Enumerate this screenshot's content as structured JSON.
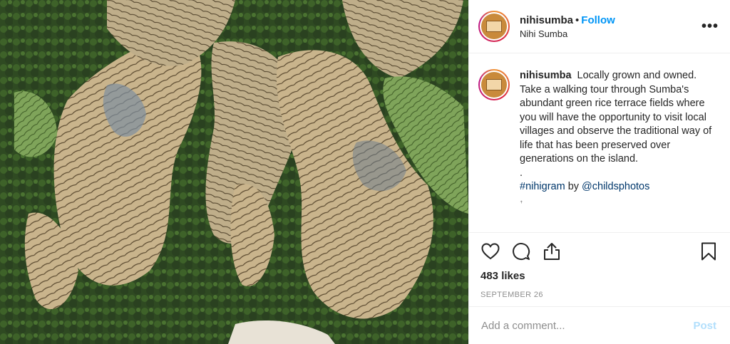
{
  "photo": {
    "icon": "aerial-rice-terraces-image"
  },
  "header": {
    "username": "nihisumba",
    "separator": "•",
    "follow_label": "Follow",
    "location": "Nihi Sumba",
    "more_label": "•••"
  },
  "caption": {
    "username": "nihisumba",
    "text": "Locally grown and owned. Take a walking tour through Sumba's abundant green rice terrace fields where you will have the opportunity to visit local villages and observe the traditional way of life that has been preserved over generations on the island.",
    "dot": ".",
    "hashtag": "#nihigram",
    "by": " by ",
    "mention": "@childsphotos",
    "more_hint": "ꜛ"
  },
  "actions": {
    "like_icon": "heart-icon",
    "comment_icon": "comment-icon",
    "share_icon": "share-icon",
    "save_icon": "bookmark-icon"
  },
  "likes": "483 likes",
  "date": "SEPTEMBER 26",
  "add_comment": {
    "placeholder": "Add a comment...",
    "post_label": "Post"
  },
  "colors": {
    "accent": "#0095f6",
    "post_disabled": "#b2dffc",
    "text": "#262626",
    "muted": "#8e8e8e"
  }
}
